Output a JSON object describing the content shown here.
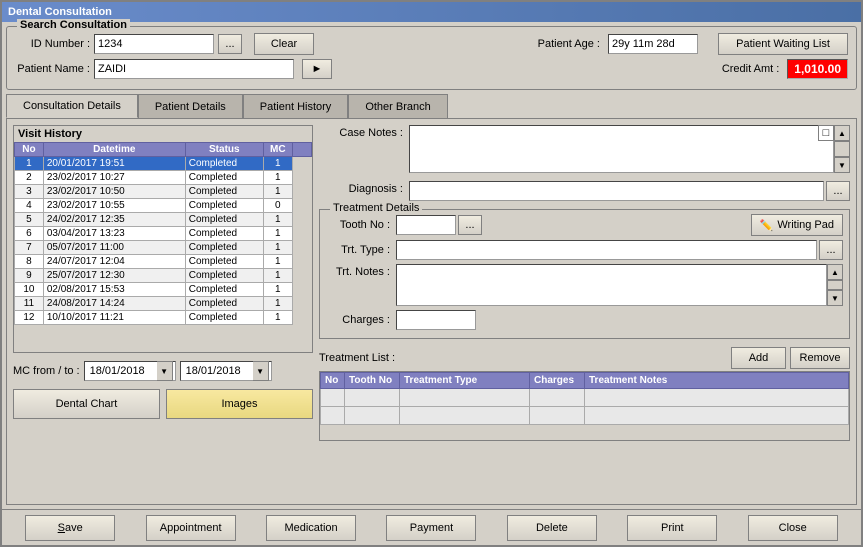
{
  "window": {
    "title": "Dental Consultation"
  },
  "search_group": {
    "label": "Search Consultation",
    "id_label": "ID Number :",
    "id_value": "1234",
    "browse_btn": "...",
    "clear_btn": "Clear",
    "patient_label": "Patient Name :",
    "patient_value": "ZAIDI",
    "patient_age_label": "Patient Age :",
    "patient_age_value": "29y 11m 28d",
    "credit_label": "Credit Amt :",
    "credit_value": "1,010.00",
    "waiting_list_btn": "Patient Waiting List"
  },
  "tabs": [
    {
      "id": "consultation",
      "label": "Consultation Details",
      "active": true
    },
    {
      "id": "patient",
      "label": "Patient Details",
      "active": false
    },
    {
      "id": "history",
      "label": "Patient History",
      "active": false
    },
    {
      "id": "branch",
      "label": "Other Branch",
      "active": false
    }
  ],
  "visit_history": {
    "title": "Visit History",
    "columns": [
      "No",
      "Datetime",
      "Status",
      "MC"
    ],
    "rows": [
      {
        "no": 1,
        "datetime": "20/01/2017 19:51",
        "status": "Completed",
        "mc": 1
      },
      {
        "no": 2,
        "datetime": "23/02/2017 10:27",
        "status": "Completed",
        "mc": 1
      },
      {
        "no": 3,
        "datetime": "23/02/2017 10:50",
        "status": "Completed",
        "mc": 1
      },
      {
        "no": 4,
        "datetime": "23/02/2017 10:55",
        "status": "Completed",
        "mc": 0
      },
      {
        "no": 5,
        "datetime": "24/02/2017 12:35",
        "status": "Completed",
        "mc": 1
      },
      {
        "no": 6,
        "datetime": "03/04/2017 13:23",
        "status": "Completed",
        "mc": 1
      },
      {
        "no": 7,
        "datetime": "05/07/2017 11:00",
        "status": "Completed",
        "mc": 1
      },
      {
        "no": 8,
        "datetime": "24/07/2017 12:04",
        "status": "Completed",
        "mc": 1
      },
      {
        "no": 9,
        "datetime": "25/07/2017 12:30",
        "status": "Completed",
        "mc": 1
      },
      {
        "no": 10,
        "datetime": "02/08/2017 15:53",
        "status": "Completed",
        "mc": 1
      },
      {
        "no": 11,
        "datetime": "24/08/2017 14:24",
        "status": "Completed",
        "mc": 1
      },
      {
        "no": 12,
        "datetime": "10/10/2017 11:21",
        "status": "Completed",
        "mc": 1
      }
    ]
  },
  "mc_from_to": {
    "label": "MC from / to :",
    "from_date": "18/01/2018",
    "to_date": "18/01/2018"
  },
  "buttons": {
    "dental_chart": "Dental Chart",
    "images": "Images"
  },
  "case_notes": {
    "label": "Case Notes :"
  },
  "diagnosis": {
    "label": "Diagnosis :",
    "browse_btn": "..."
  },
  "treatment_details": {
    "group_label": "Treatment Details",
    "tooth_no_label": "Tooth No :",
    "tooth_browse_btn": "...",
    "writing_pad_btn": "Writing Pad",
    "trt_type_label": "Trt. Type :",
    "trt_type_browse": "...",
    "trt_notes_label": "Trt. Notes :",
    "charges_label": "Charges :"
  },
  "treatment_list": {
    "label": "Treatment List :",
    "add_btn": "Add",
    "remove_btn": "Remove",
    "columns": [
      "No",
      "Tooth No",
      "Treatment Type",
      "Charges",
      "Treatment Notes"
    ],
    "rows": []
  },
  "bottom_buttons": [
    {
      "id": "save",
      "label": "Save"
    },
    {
      "id": "appointment",
      "label": "Appointment"
    },
    {
      "id": "medication",
      "label": "Medication"
    },
    {
      "id": "payment",
      "label": "Payment"
    },
    {
      "id": "delete",
      "label": "Delete"
    },
    {
      "id": "print",
      "label": "Print"
    },
    {
      "id": "close",
      "label": "Close"
    }
  ]
}
